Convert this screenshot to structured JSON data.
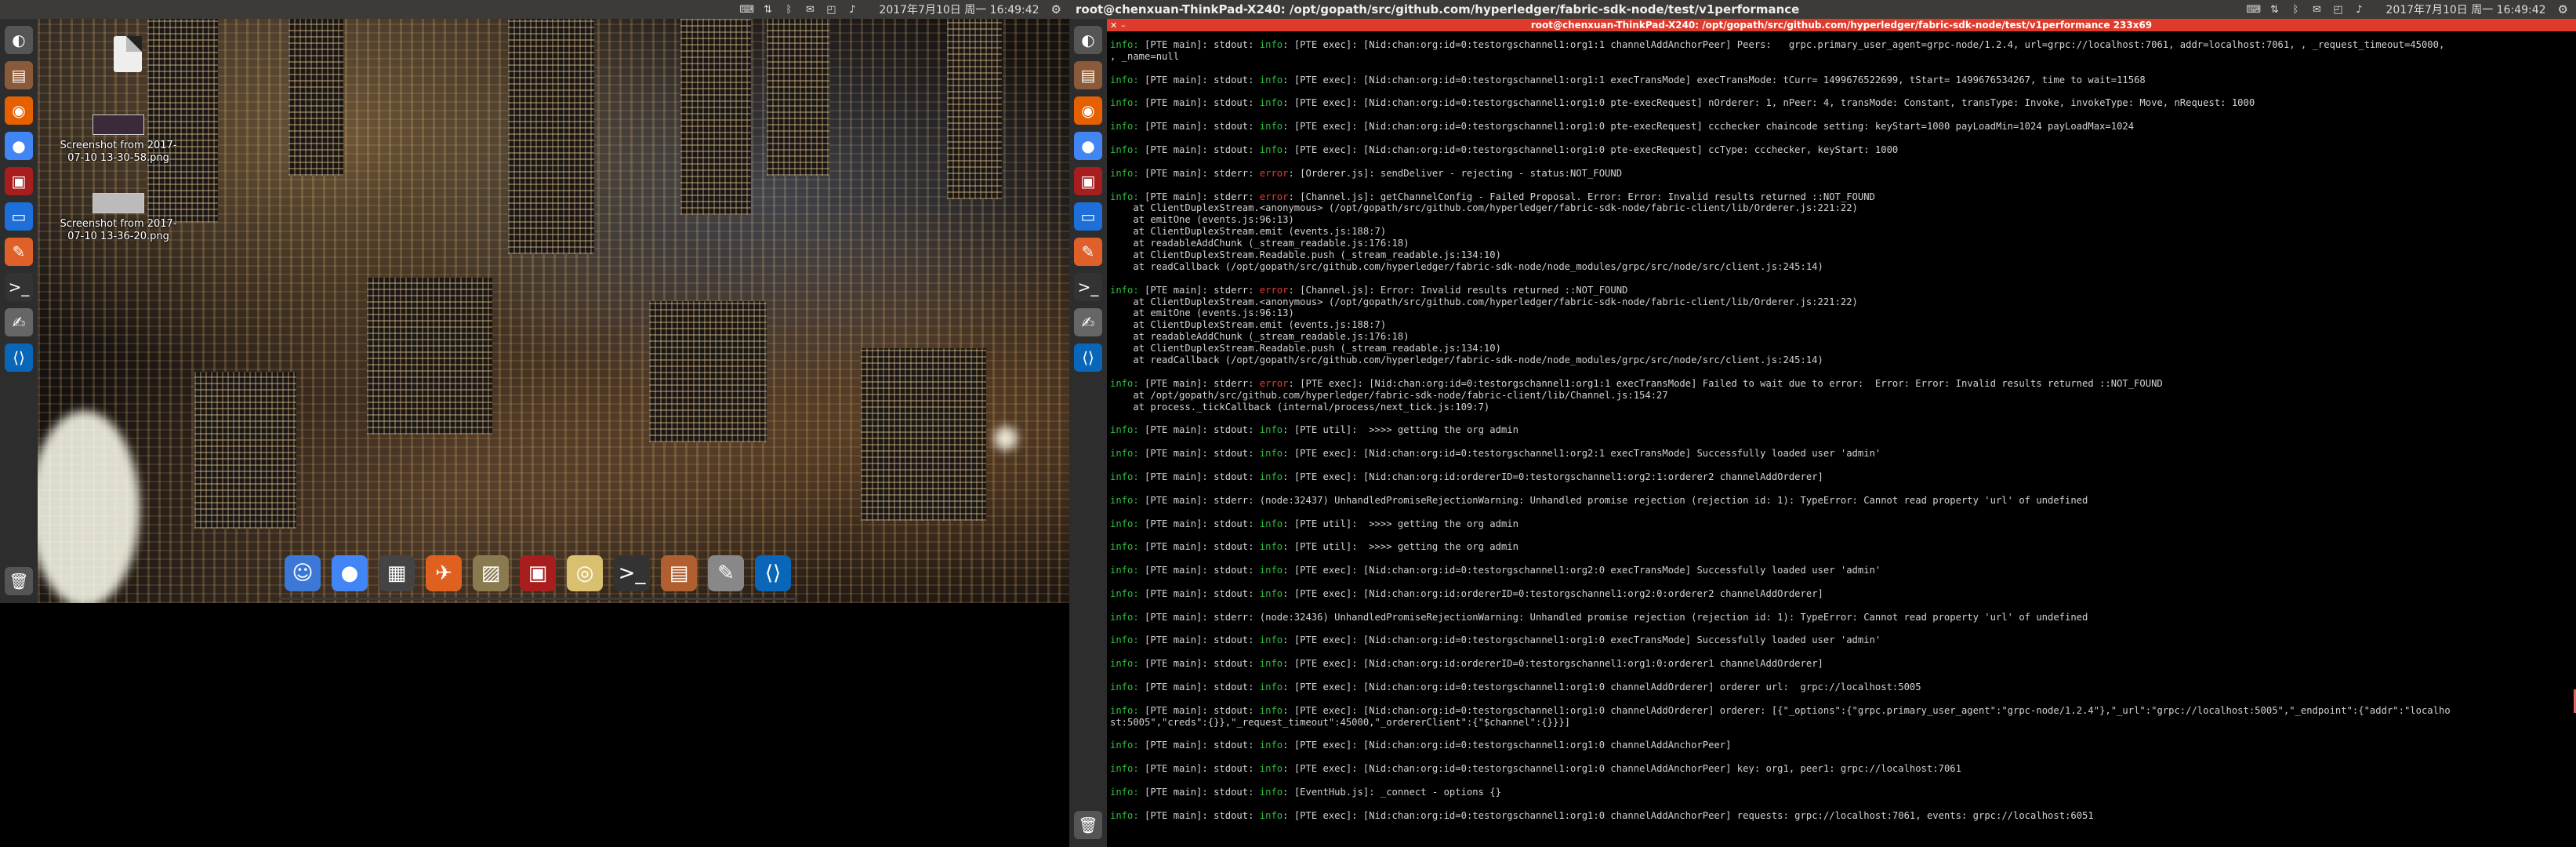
{
  "left_panel": {
    "title": "",
    "clock": "2017年7月10日 周一 16:49:42"
  },
  "right_panel": {
    "title": "root@chenxuan-ThinkPad-X240: /opt/gopath/src/github.com/hyperledger/fabric-sdk-node/test/v1performance",
    "clock": "2017年7月10日 周一 16:49:42"
  },
  "tray_icons": [
    "keyboard-icon",
    "network-icon",
    "bluetooth-icon",
    "mail-icon",
    "input-method-icon",
    "volume-icon"
  ],
  "desktop_icons": [
    {
      "label": "",
      "kind": "document"
    },
    {
      "label": "Screenshot from 2017-07-10 13-30-58.png",
      "kind": "screenshot"
    },
    {
      "label": "Screenshot from 2017-07-10 13-36-20.png",
      "kind": "screenshot"
    }
  ],
  "launcher_items": [
    {
      "name": "dash-home",
      "glyph": "◐",
      "color": "#555"
    },
    {
      "name": "files",
      "glyph": "▤",
      "color": "#8a5a3a"
    },
    {
      "name": "firefox",
      "glyph": "◉",
      "color": "#e66000"
    },
    {
      "name": "chrome",
      "glyph": "●",
      "color": "#4285f4"
    },
    {
      "name": "app-red",
      "glyph": "▣",
      "color": "#a81e1e"
    },
    {
      "name": "remote",
      "glyph": "▭",
      "color": "#1e6fd9"
    },
    {
      "name": "editor",
      "glyph": "✎",
      "color": "#e0602a"
    },
    {
      "name": "terminal",
      "glyph": ">_",
      "color": "#333"
    },
    {
      "name": "text-editor",
      "glyph": "✍",
      "color": "#666"
    },
    {
      "name": "vscode",
      "glyph": "⟨⟩",
      "color": "#0a66b8"
    }
  ],
  "dock_items": [
    {
      "name": "finder",
      "glyph": "☺",
      "color": "#3c78d8"
    },
    {
      "name": "chrome",
      "glyph": "●",
      "color": "#4285f4"
    },
    {
      "name": "clapper",
      "glyph": "▦",
      "color": "#444"
    },
    {
      "name": "rocket",
      "glyph": "✈",
      "color": "#e06020"
    },
    {
      "name": "preview",
      "glyph": "▨",
      "color": "#8a7a50"
    },
    {
      "name": "terminal-red",
      "glyph": "▣",
      "color": "#a81e1e"
    },
    {
      "name": "speaker",
      "glyph": "◎",
      "color": "#d8c070"
    },
    {
      "name": "terminal",
      "glyph": ">_",
      "color": "#333"
    },
    {
      "name": "archive",
      "glyph": "▤",
      "color": "#b06030"
    },
    {
      "name": "notes",
      "glyph": "✎",
      "color": "#888"
    },
    {
      "name": "vscode",
      "glyph": "⟨⟩",
      "color": "#0a66b8"
    }
  ],
  "terminal": {
    "title": "root@chenxuan-ThinkPad-X240: /opt/gopath/src/github.com/hyperledger/fabric-sdk-node/test/v1performance 233x69",
    "lines": [
      {
        "p": "",
        "lvl": "info",
        "t": " [PTE main]: stdout: ",
        "lvl2": "info",
        "r": ": [PTE exec]: [Nid:chan:org:id=0:testorgschannel1:org1:1 channelAddAnchorPeer] Peers:   grpc.primary_user_agent=grpc-node/1.2.4, url=grpc://localhost:7061, addr=localhost:7061, , _request_timeout=45000,"
      },
      {
        "p": ", _name=null"
      },
      {
        "p": ""
      },
      {
        "lvl": "info",
        "t": " [PTE main]: stdout: ",
        "lvl2": "info",
        "r": ": [PTE exec]: [Nid:chan:org:id=0:testorgschannel1:org1:1 execTransMode] execTransMode: tCurr= 1499676522699, tStart= 1499676534267, time to wait=11568"
      },
      {
        "p": ""
      },
      {
        "lvl": "info",
        "t": " [PTE main]: stdout: ",
        "lvl2": "info",
        "r": ": [PTE exec]: [Nid:chan:org:id=0:testorgschannel1:org1:0 pte-execRequest] nOrderer: 1, nPeer: 4, transMode: Constant, transType: Invoke, invokeType: Move, nRequest: 1000"
      },
      {
        "p": ""
      },
      {
        "lvl": "info",
        "t": " [PTE main]: stdout: ",
        "lvl2": "info",
        "r": ": [PTE exec]: [Nid:chan:org:id=0:testorgschannel1:org1:0 pte-execRequest] ccchecker chaincode setting: keyStart=1000 payLoadMin=1024 payLoadMax=1024"
      },
      {
        "p": ""
      },
      {
        "lvl": "info",
        "t": " [PTE main]: stdout: ",
        "lvl2": "info",
        "r": ": [PTE exec]: [Nid:chan:org:id=0:testorgschannel1:org1:0 pte-execRequest] ccType: ccchecker, keyStart: 1000"
      },
      {
        "p": ""
      },
      {
        "lvl": "info",
        "t": " [PTE main]: stderr: ",
        "lvl2": "error",
        "r": ": [Orderer.js]: sendDeliver - rejecting - status:NOT_FOUND"
      },
      {
        "p": ""
      },
      {
        "lvl": "info",
        "t": " [PTE main]: stderr: ",
        "lvl2": "error",
        "r": ": [Channel.js]: getChannelConfig - Failed Proposal. Error: Error: Invalid results returned ::NOT_FOUND"
      },
      {
        "p": "    at ClientDuplexStream.<anonymous> (/opt/gopath/src/github.com/hyperledger/fabric-sdk-node/fabric-client/lib/Orderer.js:221:22)"
      },
      {
        "p": "    at emitOne (events.js:96:13)"
      },
      {
        "p": "    at ClientDuplexStream.emit (events.js:188:7)"
      },
      {
        "p": "    at readableAddChunk (_stream_readable.js:176:18)"
      },
      {
        "p": "    at ClientDuplexStream.Readable.push (_stream_readable.js:134:10)"
      },
      {
        "p": "    at readCallback (/opt/gopath/src/github.com/hyperledger/fabric-sdk-node/node_modules/grpc/src/node/src/client.js:245:14)"
      },
      {
        "p": ""
      },
      {
        "lvl": "info",
        "t": " [PTE main]: stderr: ",
        "lvl2": "error",
        "r": ": [Channel.js]: Error: Invalid results returned ::NOT_FOUND"
      },
      {
        "p": "    at ClientDuplexStream.<anonymous> (/opt/gopath/src/github.com/hyperledger/fabric-sdk-node/fabric-client/lib/Orderer.js:221:22)"
      },
      {
        "p": "    at emitOne (events.js:96:13)"
      },
      {
        "p": "    at ClientDuplexStream.emit (events.js:188:7)"
      },
      {
        "p": "    at readableAddChunk (_stream_readable.js:176:18)"
      },
      {
        "p": "    at ClientDuplexStream.Readable.push (_stream_readable.js:134:10)"
      },
      {
        "p": "    at readCallback (/opt/gopath/src/github.com/hyperledger/fabric-sdk-node/node_modules/grpc/src/node/src/client.js:245:14)"
      },
      {
        "p": ""
      },
      {
        "lvl": "info",
        "t": " [PTE main]: stderr: ",
        "lvl2": "error",
        "r": ": [PTE exec]: [Nid:chan:org:id=0:testorgschannel1:org1:1 execTransMode] Failed to wait due to error:  Error: Error: Invalid results returned ::NOT_FOUND"
      },
      {
        "p": "    at /opt/gopath/src/github.com/hyperledger/fabric-sdk-node/fabric-client/lib/Channel.js:154:27"
      },
      {
        "p": "    at process._tickCallback (internal/process/next_tick.js:109:7)"
      },
      {
        "p": ""
      },
      {
        "lvl": "info",
        "t": " [PTE main]: stdout: ",
        "lvl2": "info",
        "r": ": [PTE util]:  >>>> getting the org admin"
      },
      {
        "p": ""
      },
      {
        "lvl": "info",
        "t": " [PTE main]: stdout: ",
        "lvl2": "info",
        "r": ": [PTE exec]: [Nid:chan:org:id=0:testorgschannel1:org2:1 execTransMode] Successfully loaded user 'admin'"
      },
      {
        "p": ""
      },
      {
        "lvl": "info",
        "t": " [PTE main]: stdout: ",
        "lvl2": "info",
        "r": ": [PTE exec]: [Nid:chan:org:id:ordererID=0:testorgschannel1:org2:1:orderer2 channelAddOrderer]"
      },
      {
        "p": ""
      },
      {
        "lvl": "info",
        "t": " [PTE main]: stderr: (node:32437) UnhandledPromiseRejectionWarning: Unhandled promise rejection (rejection id: 1): TypeError: Cannot read property 'url' of undefined"
      },
      {
        "p": ""
      },
      {
        "lvl": "info",
        "t": " [PTE main]: stdout: ",
        "lvl2": "info",
        "r": ": [PTE util]:  >>>> getting the org admin"
      },
      {
        "p": ""
      },
      {
        "lvl": "info",
        "t": " [PTE main]: stdout: ",
        "lvl2": "info",
        "r": ": [PTE util]:  >>>> getting the org admin"
      },
      {
        "p": ""
      },
      {
        "lvl": "info",
        "t": " [PTE main]: stdout: ",
        "lvl2": "info",
        "r": ": [PTE exec]: [Nid:chan:org:id=0:testorgschannel1:org2:0 execTransMode] Successfully loaded user 'admin'"
      },
      {
        "p": ""
      },
      {
        "lvl": "info",
        "t": " [PTE main]: stdout: ",
        "lvl2": "info",
        "r": ": [PTE exec]: [Nid:chan:org:id:ordererID=0:testorgschannel1:org2:0:orderer2 channelAddOrderer]"
      },
      {
        "p": ""
      },
      {
        "lvl": "info",
        "t": " [PTE main]: stderr: (node:32436) UnhandledPromiseRejectionWarning: Unhandled promise rejection (rejection id: 1): TypeError: Cannot read property 'url' of undefined"
      },
      {
        "p": ""
      },
      {
        "lvl": "info",
        "t": " [PTE main]: stdout: ",
        "lvl2": "info",
        "r": ": [PTE exec]: [Nid:chan:org:id=0:testorgschannel1:org1:0 execTransMode] Successfully loaded user 'admin'"
      },
      {
        "p": ""
      },
      {
        "lvl": "info",
        "t": " [PTE main]: stdout: ",
        "lvl2": "info",
        "r": ": [PTE exec]: [Nid:chan:org:id:ordererID=0:testorgschannel1:org1:0:orderer1 channelAddOrderer]"
      },
      {
        "p": ""
      },
      {
        "lvl": "info",
        "t": " [PTE main]: stdout: ",
        "lvl2": "info",
        "r": ": [PTE exec]: [Nid:chan:org:id=0:testorgschannel1:org1:0 channelAddOrderer] orderer url:  grpc://localhost:5005"
      },
      {
        "p": ""
      },
      {
        "lvl": "info",
        "t": " [PTE main]: stdout: ",
        "lvl2": "info",
        "r": ": [PTE exec]: [Nid:chan:org:id=0:testorgschannel1:org1:0 channelAddOrderer] orderer: [{\"_options\":{\"grpc.primary_user_agent\":\"grpc-node/1.2.4\"},\"_url\":\"grpc://localhost:5005\",\"_endpoint\":{\"addr\":\"localho"
      },
      {
        "p": "st:5005\",\"creds\":{}},\"_request_timeout\":45000,\"_ordererClient\":{\"$channel\":{}}}]"
      },
      {
        "p": ""
      },
      {
        "lvl": "info",
        "t": " [PTE main]: stdout: ",
        "lvl2": "info",
        "r": ": [PTE exec]: [Nid:chan:org:id=0:testorgschannel1:org1:0 channelAddAnchorPeer]"
      },
      {
        "p": ""
      },
      {
        "lvl": "info",
        "t": " [PTE main]: stdout: ",
        "lvl2": "info",
        "r": ": [PTE exec]: [Nid:chan:org:id=0:testorgschannel1:org1:0 channelAddAnchorPeer] key: org1, peer1: grpc://localhost:7061"
      },
      {
        "p": ""
      },
      {
        "lvl": "info",
        "t": " [PTE main]: stdout: ",
        "lvl2": "info",
        "r": ": [EventHub.js]: _connect - options {}"
      },
      {
        "p": ""
      },
      {
        "lvl": "info",
        "t": " [PTE main]: stdout: ",
        "lvl2": "info",
        "r": ": [PTE exec]: [Nid:chan:org:id=0:testorgschannel1:org1:0 channelAddAnchorPeer] requests: grpc://localhost:7061, events: grpc://localhost:6051"
      }
    ]
  }
}
